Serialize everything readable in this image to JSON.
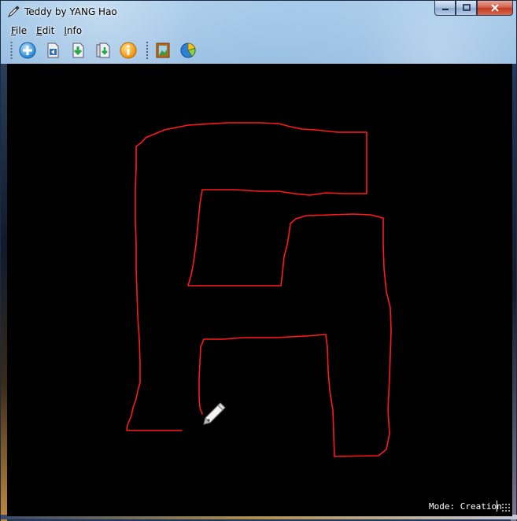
{
  "window": {
    "title": "Teddy by YANG Hao",
    "controls": {
      "minimize": "minimize",
      "maximize": "maximize",
      "close": "close"
    }
  },
  "menu": {
    "items": [
      {
        "label": "File",
        "accel": "F",
        "rest": "ile"
      },
      {
        "label": "Edit",
        "accel": "E",
        "rest": "dit"
      },
      {
        "label": "Info",
        "accel": "I",
        "rest": "nfo"
      }
    ]
  },
  "toolbar": {
    "buttons": [
      {
        "icon": "new-plus-icon"
      },
      {
        "icon": "open-file-icon"
      },
      {
        "icon": "save-file-icon"
      },
      {
        "icon": "export-file-icon"
      },
      {
        "icon": "info-icon"
      },
      {
        "icon": "image-picture-icon"
      },
      {
        "icon": "pie-chart-icon"
      }
    ]
  },
  "canvas": {
    "background": "#000000",
    "stroke_color": "#ff1a1a",
    "cursor_icon": "pen-cursor-icon"
  },
  "status": {
    "mode_text": "Mode: Creation"
  }
}
